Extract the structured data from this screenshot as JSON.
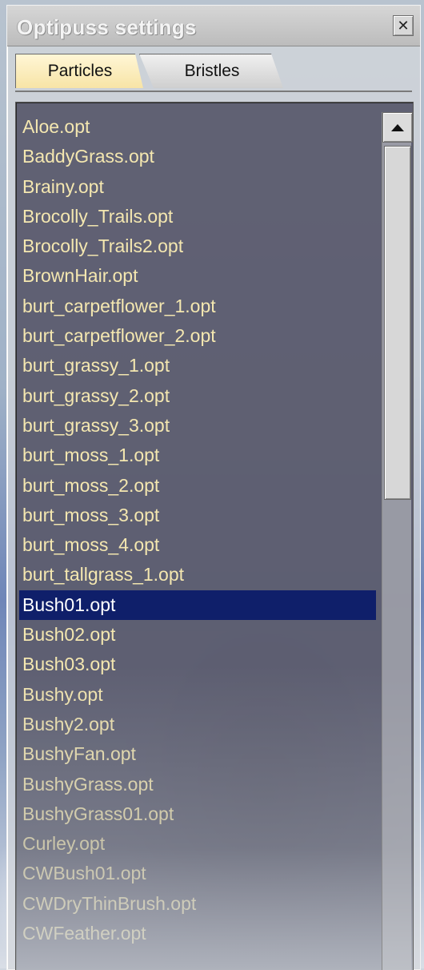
{
  "window": {
    "title": "Optipuss settings",
    "close_glyph": "✕",
    "close_icon": "close-icon"
  },
  "tabs": [
    {
      "label": "Particles",
      "active": true
    },
    {
      "label": "Bristles",
      "active": false
    }
  ],
  "file_list": {
    "selected_index": 16,
    "items": [
      "Aloe.opt",
      "BaddyGrass.opt",
      "Brainy.opt",
      "Brocolly_Trails.opt",
      "Brocolly_Trails2.opt",
      "BrownHair.opt",
      "burt_carpetflower_1.opt",
      "burt_carpetflower_2.opt",
      "burt_grassy_1.opt",
      "burt_grassy_2.opt",
      "burt_grassy_3.opt",
      "burt_moss_1.opt",
      "burt_moss_2.opt",
      "burt_moss_3.opt",
      "burt_moss_4.opt",
      "burt_tallgrass_1.opt",
      "Bush01.opt",
      "Bush02.opt",
      "Bush03.opt",
      "Bushy.opt",
      "Bushy2.opt",
      "BushyFan.opt",
      "BushyGrass.opt",
      "BushyGrass01.opt",
      "Curley.opt",
      "CWBush01.opt",
      "CWDryThinBrush.opt",
      "CWFeather.opt"
    ]
  },
  "colors": {
    "list_text": "#f4e7b0",
    "selection": "#0f1f6a",
    "active_tab": "#f7e4a6"
  }
}
